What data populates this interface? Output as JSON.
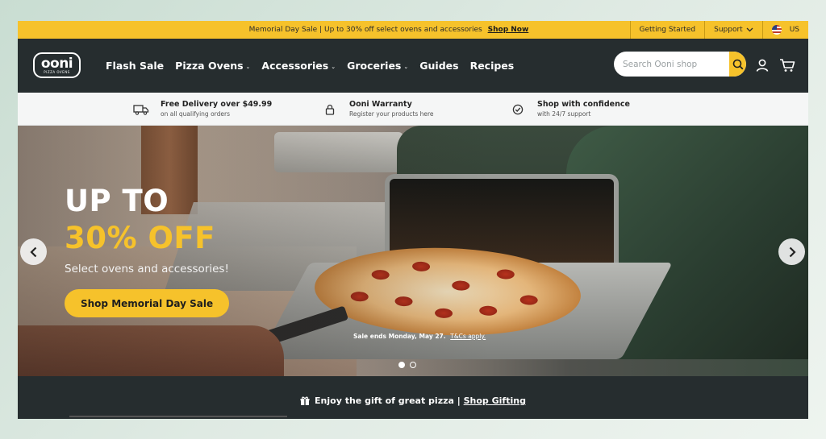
{
  "promo": {
    "text": "Memorial Day Sale | Up to 30% off select ovens and accessories",
    "link": "Shop Now",
    "getting_started": "Getting Started",
    "support": "Support",
    "region": "US"
  },
  "brand": {
    "name": "ooni",
    "tagline": "PIZZA OVENS"
  },
  "nav": {
    "items": [
      {
        "label": "Flash Sale",
        "dropdown": false
      },
      {
        "label": "Pizza Ovens",
        "dropdown": true
      },
      {
        "label": "Accessories",
        "dropdown": true
      },
      {
        "label": "Groceries",
        "dropdown": true
      },
      {
        "label": "Guides",
        "dropdown": false
      },
      {
        "label": "Recipes",
        "dropdown": false
      }
    ],
    "dropdown_glyph": "⌄",
    "search_placeholder": "Search Ooni shop"
  },
  "trust": [
    {
      "icon": "delivery-truck-icon",
      "title": "Free Delivery over $49.99",
      "subtitle": "on all qualifying orders"
    },
    {
      "icon": "lock-icon",
      "title": "Ooni Warranty",
      "subtitle": "Register your products here"
    },
    {
      "icon": "check-badge-icon",
      "title": "Shop with confidence",
      "subtitle": "with 24/7 support"
    }
  ],
  "hero": {
    "line1": "UP TO",
    "line2": "30% OFF",
    "subtitle": "Select ovens and accessories!",
    "cta": "Shop Memorial Day Sale",
    "note": "Sale ends Monday, May 27.",
    "note_link": "T&Cs apply.",
    "slides": 2,
    "active_slide": 1
  },
  "gift": {
    "text": "Enjoy the gift of great pizza |",
    "link": "Shop Gifting"
  },
  "colors": {
    "accent": "#f6c22b",
    "nav_bg": "#262d2f",
    "trust_bg": "#f5f6f6"
  }
}
